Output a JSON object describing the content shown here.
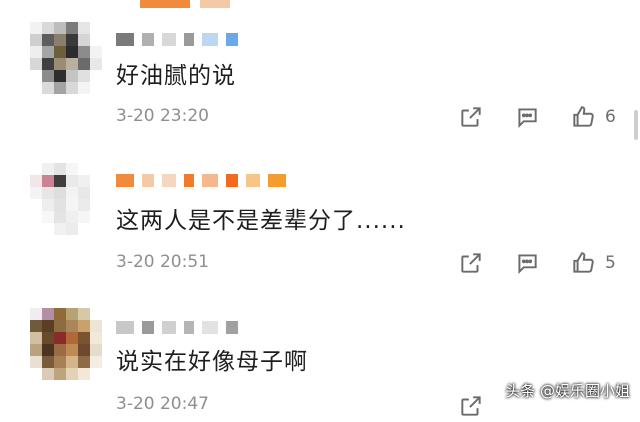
{
  "comments": [
    {
      "text": "好油腻的说",
      "time": "3-20 23:20",
      "likes": "6",
      "name_blocks": [
        "#7a7a7a",
        "#b0b0b0",
        "#d8d8d8",
        "#9a9a9a",
        "#bcd7f2",
        "#6aa8e8"
      ],
      "avatar_colors": [
        "#f2f2f2",
        "#d9d9d9",
        "#bdbdbd",
        "#7b7b7b",
        "#e6e6e6",
        "#ffffff",
        "#cfcfcf",
        "#5d5d5d",
        "#8a7f6a",
        "#3a3a3a",
        "#d5d5d5",
        "#ffffff",
        "#eeeeee",
        "#a5a5a5",
        "#6d5f3d",
        "#2c2c2c",
        "#8c8c8c",
        "#f3f3f3",
        "#d7d7d7",
        "#404040",
        "#9b8d73",
        "#b9b0a0",
        "#6b6b6b",
        "#e8e8e8",
        "#ffffff",
        "#8c8c8c",
        "#2e2e2e",
        "#c4c4c4",
        "#e0e0e0",
        "#ffffff",
        "#ffffff",
        "#dadada",
        "#a3a3a3",
        "#d8d8d8",
        "#f4f4f4",
        "#ffffff"
      ]
    },
    {
      "text": "这两人是不是差辈分了......",
      "time": "3-20 20:51",
      "likes": "5",
      "name_blocks": [
        "#f08a3c",
        "#f4c9a6",
        "#f5d6bf",
        "#f07b2c",
        "#f3b98c",
        "#f06a20",
        "#f7c58a",
        "#f59c2e"
      ],
      "avatar_colors": [
        "#ffffff",
        "#f0f0f0",
        "#e3e3e3",
        "#f6f6f6",
        "#ffffff",
        "#ffffff",
        "#f2e6e9",
        "#c98393",
        "#3f3f3f",
        "#e9e9e9",
        "#f0f0f0",
        "#ffffff",
        "#f4f4f4",
        "#e6e6e6",
        "#dedede",
        "#f3f3f3",
        "#e8e8e8",
        "#ffffff",
        "#ffffff",
        "#eeeeee",
        "#e2e2e2",
        "#f5f5f5",
        "#ebebeb",
        "#ffffff",
        "#ffffff",
        "#f7f7f7",
        "#e4e4e4",
        "#efefef",
        "#f6f6f6",
        "#ffffff",
        "#ffffff",
        "#ffffff",
        "#f1f1f1",
        "#ececec",
        "#ffffff",
        "#ffffff"
      ]
    },
    {
      "text": "说实在好像母子啊",
      "time": "3-20 20:47",
      "likes": "",
      "name_blocks": [
        "#c8c8c8",
        "#9a9a9a",
        "#d0d0d0",
        "#b5b5b5",
        "#e2e2e2",
        "#a0a0a0"
      ],
      "avatar_colors": [
        "#f0ecef",
        "#b28fa5",
        "#8f6b3a",
        "#b7a273",
        "#d6c9a9",
        "#ffffff",
        "#6f5a3a",
        "#5a3f25",
        "#8c6d40",
        "#a9875a",
        "#c9a26b",
        "#ede4d6",
        "#d0c0a0",
        "#6a4a2a",
        "#8a2a2a",
        "#b06a3a",
        "#7a5430",
        "#f2e8da",
        "#b9a27d",
        "#4b3522",
        "#9a6b45",
        "#c08a55",
        "#6d4a2e",
        "#e7dccb",
        "#e8e0d0",
        "#7a5b3c",
        "#a88055",
        "#d4b48a",
        "#8c6b46",
        "#f3ede3",
        "#ffffff",
        "#d9cbb6",
        "#bfa37c",
        "#e2d2b8",
        "#f1e8da",
        "#ffffff"
      ]
    }
  ],
  "watermark": "头条 @娱乐圈小姐",
  "icons": {
    "share": "share-icon",
    "reply": "comment-icon",
    "like": "thumbs-up-icon"
  }
}
